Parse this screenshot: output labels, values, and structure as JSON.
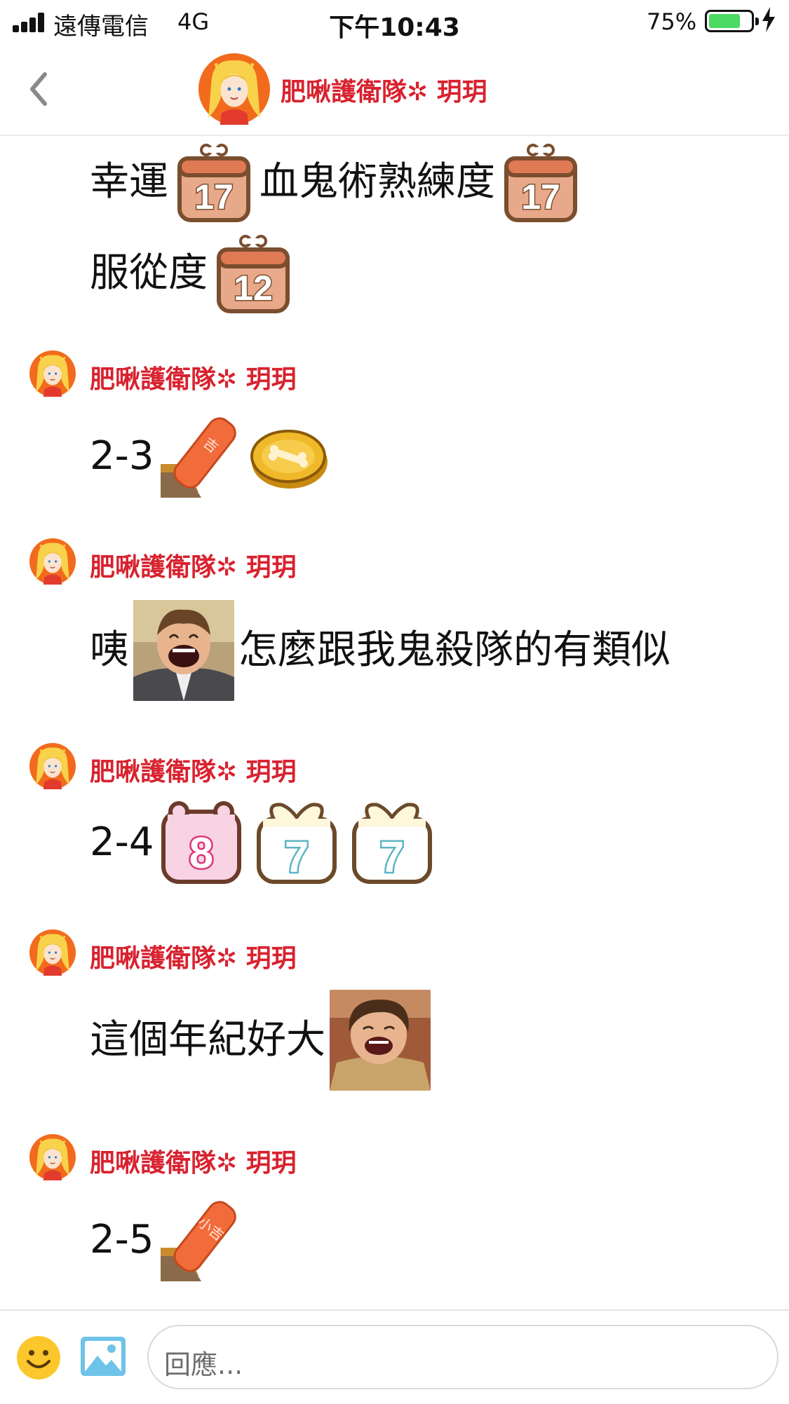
{
  "status_bar": {
    "carrier": "遠傳電信",
    "network": "4G",
    "time": "下午10:43",
    "battery_percent": "75%",
    "battery_level": 0.75,
    "battery_color": "#4cd964"
  },
  "header": {
    "back_icon": "chevron-left-icon",
    "title": "肥啾護衛隊✲ 玥玥",
    "accent_color": "#d8222f"
  },
  "messages": [
    {
      "sender": "",
      "lines": [
        {
          "parts": [
            {
              "type": "text",
              "value": "幸運"
            },
            {
              "type": "sticker",
              "icon": "calendar-number-icon",
              "value": "17"
            },
            {
              "type": "text",
              "value": "血鬼術熟練度"
            },
            {
              "type": "sticker",
              "icon": "calendar-number-icon",
              "value": "17"
            }
          ]
        },
        {
          "parts": [
            {
              "type": "text",
              "value": "服從度"
            },
            {
              "type": "sticker",
              "icon": "calendar-number-icon",
              "value": "12"
            }
          ]
        }
      ]
    },
    {
      "sender": "肥啾護衛隊✲ 玥玥",
      "lines": [
        {
          "parts": [
            {
              "type": "text",
              "value": "2-3"
            },
            {
              "type": "sticker",
              "icon": "fortune-stick-icon",
              "value": "吉"
            },
            {
              "type": "sticker",
              "icon": "bone-coin-icon"
            }
          ]
        }
      ]
    },
    {
      "sender": "肥啾護衛隊✲ 玥玥",
      "lines": [
        {
          "parts": [
            {
              "type": "text",
              "value": "咦"
            },
            {
              "type": "image",
              "icon": "laughing-man-photo-icon"
            },
            {
              "type": "text",
              "value": "怎麼跟我鬼殺隊的有類似"
            }
          ]
        }
      ]
    },
    {
      "sender": "肥啾護衛隊✲ 玥玥",
      "lines": [
        {
          "parts": [
            {
              "type": "text",
              "value": "2-4"
            },
            {
              "type": "sticker",
              "icon": "pink-number-box-icon",
              "value": "8"
            },
            {
              "type": "sticker",
              "icon": "gift-number-box-icon",
              "value": "7"
            },
            {
              "type": "sticker",
              "icon": "gift-number-box-icon",
              "value": "7"
            }
          ]
        }
      ]
    },
    {
      "sender": "肥啾護衛隊✲ 玥玥",
      "lines": [
        {
          "parts": [
            {
              "type": "text",
              "value": "這個年紀好大"
            },
            {
              "type": "image",
              "icon": "laughing-person-photo-icon"
            }
          ]
        }
      ]
    },
    {
      "sender": "肥啾護衛隊✲ 玥玥",
      "lines": [
        {
          "parts": [
            {
              "type": "text",
              "value": "2-5"
            },
            {
              "type": "sticker",
              "icon": "fortune-stick-icon",
              "value": "小吉"
            }
          ]
        }
      ]
    }
  ],
  "input_bar": {
    "emoji_icon": "smiley-face-icon",
    "image_icon": "image-picker-icon",
    "placeholder": "回應..."
  }
}
